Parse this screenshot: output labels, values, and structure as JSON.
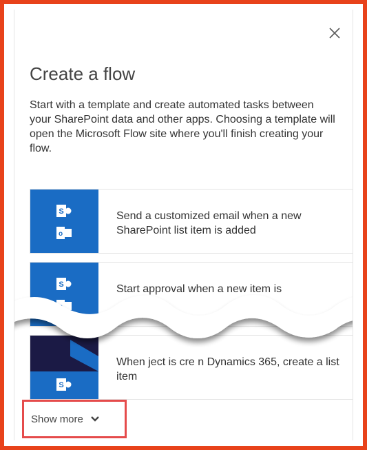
{
  "dialog": {
    "title": "Create a flow",
    "description": "Start with a template and create automated tasks between your SharePoint data and other apps. Choosing a template will open the Microsoft Flow site where you'll finish creating your flow."
  },
  "templates": [
    {
      "label": "Send a customized email when a new SharePoint list item is added",
      "icons": [
        "sharepoint-icon",
        "outlook-icon"
      ]
    },
    {
      "label": "Start approval when a new item is",
      "icons": [
        "sharepoint-icon",
        "outlook-icon"
      ]
    },
    {
      "label": "When  ject is cre    n Dynamics 365, create a list item",
      "icons": [
        "dynamics-icon",
        "sharepoint-icon"
      ]
    }
  ],
  "show_more": {
    "label": "Show more"
  },
  "colors": {
    "highlight_frame": "#e8421a",
    "highlight_box": "#e54b4b",
    "tile_blue": "#1a6cc4",
    "dynamics_navy": "#1b1a45"
  }
}
